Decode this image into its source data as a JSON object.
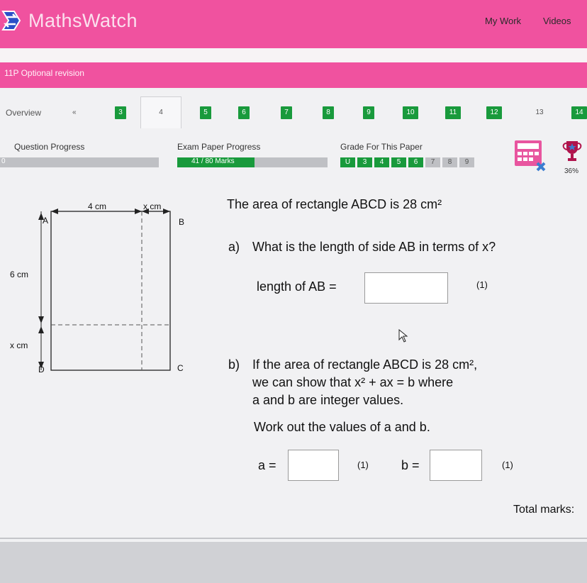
{
  "header": {
    "logo_text": "MathsWatch",
    "nav": [
      "My Work",
      "Videos"
    ]
  },
  "subbar": {
    "title": "11P Optional revision"
  },
  "tabs": {
    "overview": "Overview",
    "prev": "«",
    "numbers": [
      "3",
      "4",
      "5",
      "6",
      "7",
      "8",
      "9",
      "10",
      "11",
      "12",
      "13",
      "14"
    ],
    "active": "4"
  },
  "progress": {
    "question_label": "Question Progress",
    "question_value": "0",
    "exam_label": "Exam Paper Progress",
    "exam_value": "41 / 80 Marks",
    "exam_fraction": 0.5125,
    "grade_label": "Grade For This Paper",
    "grades": [
      "U",
      "3",
      "4",
      "5",
      "6",
      "7",
      "8",
      "9"
    ],
    "grades_achieved": 5,
    "percent": "36%"
  },
  "diagram": {
    "top_left": "4 cm",
    "top_right": "x cm",
    "left_top": "6 cm",
    "left_bottom": "x cm",
    "corner_a": "A",
    "corner_b": "B",
    "corner_c": "C",
    "corner_d": "D"
  },
  "question": {
    "intro": "The area of rectangle ABCD is 28 cm²",
    "part_a_label": "a)",
    "part_a_text": "What is the length of side AB in terms of x?",
    "ab_label": "length of AB =",
    "mark_a": "(1)",
    "part_b_label": "b)",
    "part_b_line1": "If the area of rectangle ABCD is 28 cm²,",
    "part_b_line2": "we can show that   x² + ax = b where",
    "part_b_line3": "a and b are integer values.",
    "part_b_line4": "Work out the values of a and b.",
    "a_label": "a =",
    "mark_b1": "(1)",
    "b_label": "b =",
    "mark_b2": "(1)",
    "total_label": "Total marks:"
  },
  "colors": {
    "pink": "#f0529f",
    "green": "#199a3c",
    "blue": "#3a7dd0"
  }
}
